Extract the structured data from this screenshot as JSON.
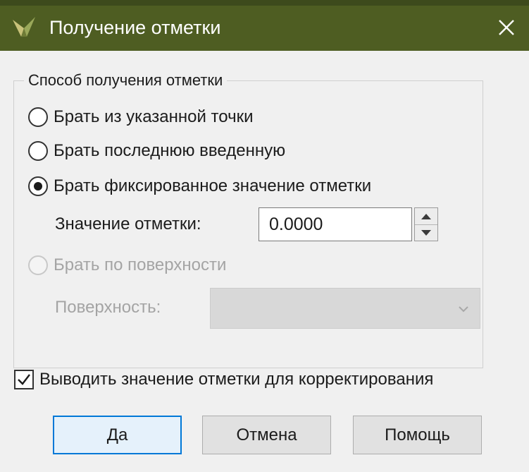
{
  "window": {
    "title": "Получение отметки",
    "titlebar_color": "#4e5d22",
    "icon": "app-logo-icon",
    "close_icon": "close-icon"
  },
  "group": {
    "label": "Способ получения отметки",
    "options": [
      {
        "label": "Брать из указанной точки",
        "checked": false,
        "enabled": true
      },
      {
        "label": "Брать последнюю введенную",
        "checked": false,
        "enabled": true
      },
      {
        "label": "Брать фиксированное значение отметки",
        "checked": true,
        "enabled": true
      },
      {
        "label": "Брать по поверхности",
        "checked": false,
        "enabled": false
      }
    ],
    "elevation": {
      "label": "Значение отметки:",
      "value": "0.0000"
    },
    "surface": {
      "label": "Поверхность:",
      "value": "",
      "enabled": false
    }
  },
  "show_for_correction": {
    "label": "Выводить значение отметки для корректирования",
    "checked": true
  },
  "buttons": {
    "ok": "Да",
    "cancel": "Отмена",
    "help": "Помощь"
  },
  "colors": {
    "accent": "#0078d7",
    "disabled_text": "#a4a4a4"
  }
}
